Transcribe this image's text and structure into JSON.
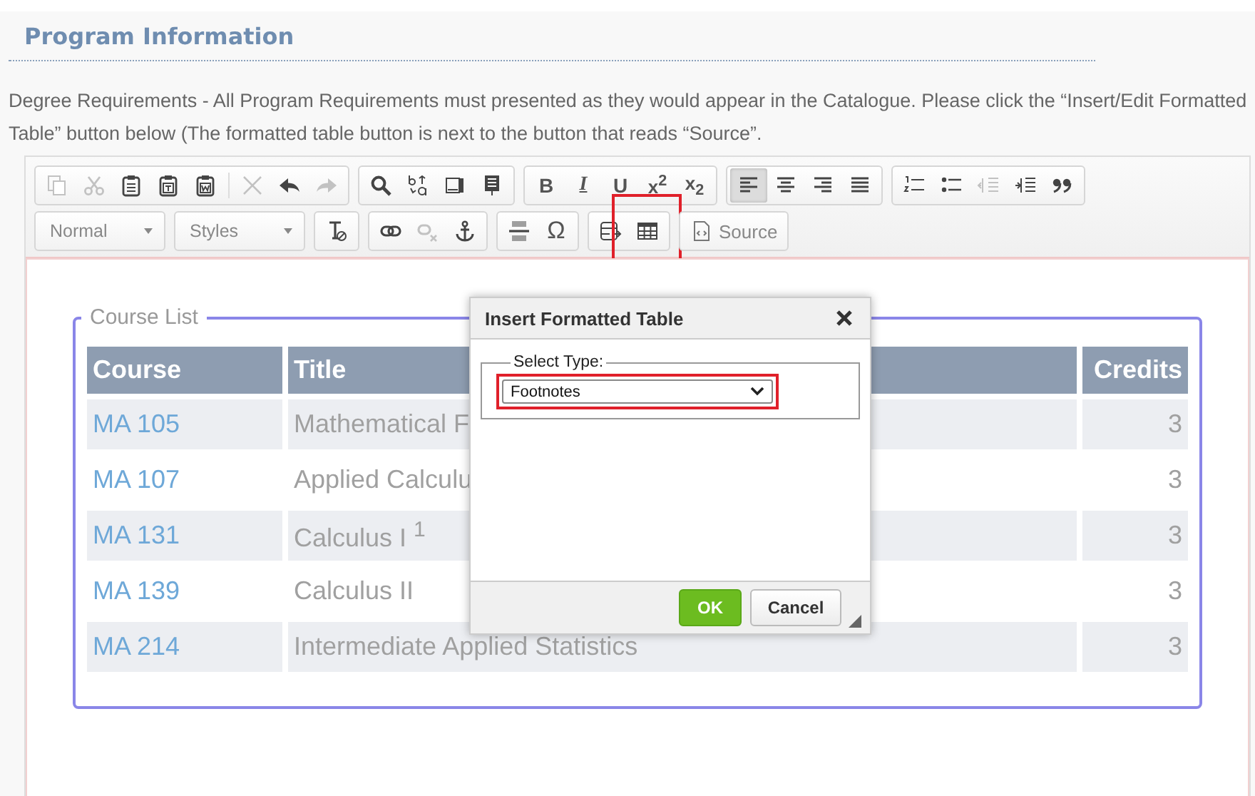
{
  "page": {
    "title": "Program Information",
    "instructions": "Degree Requirements - All Program Requirements must presented as they would appear in the Catalogue. Please click the “Insert/Edit Formatted Table” button below (The formatted table button is next to the button that reads “Source”."
  },
  "toolbar": {
    "rows": [
      [
        {
          "items": [
            {
              "kind": "copy",
              "disabled": true
            },
            {
              "kind": "cut",
              "disabled": true
            },
            {
              "kind": "paste",
              "disabled": false
            },
            {
              "kind": "pastetext",
              "disabled": false
            },
            {
              "kind": "pasteword",
              "disabled": false
            },
            {
              "kind": "sep"
            },
            {
              "kind": "remove",
              "disabled": true
            },
            {
              "kind": "undo",
              "disabled": false
            },
            {
              "kind": "redo",
              "disabled": true
            }
          ]
        },
        {
          "items": [
            {
              "kind": "find",
              "disabled": false
            },
            {
              "kind": "replace",
              "disabled": false
            },
            {
              "kind": "selectall",
              "disabled": false
            },
            {
              "kind": "page",
              "disabled": false
            }
          ]
        },
        {
          "items": [
            {
              "kind": "bold",
              "label": "B",
              "disabled": false
            },
            {
              "kind": "italic",
              "label": "I",
              "disabled": false
            },
            {
              "kind": "underline",
              "label": "U",
              "disabled": false
            },
            {
              "kind": "script",
              "label": "x$^{2}$",
              "disabled": false
            },
            {
              "kind": "script",
              "label": "x$_{2}$",
              "disabled": false
            }
          ]
        },
        {
          "items": [
            {
              "kind": "alignleft",
              "selected": true
            },
            {
              "kind": "aligncenter",
              "selected": false
            },
            {
              "kind": "alignright",
              "selected": false
            },
            {
              "kind": "justify",
              "selected": false
            }
          ]
        },
        {
          "items": [
            {
              "kind": "numlist",
              "disabled": false
            },
            {
              "kind": "bullist",
              "disabled": false
            },
            {
              "kind": "outdent",
              "disabled": true
            },
            {
              "kind": "indent",
              "disabled": false
            },
            {
              "kind": "quote",
              "disabled": false
            }
          ]
        }
      ],
      [
        {
          "items": [
            {
              "kind": "combo",
              "label": "Normal"
            }
          ]
        },
        {
          "items": [
            {
              "kind": "combo",
              "label": "Styles"
            }
          ]
        },
        {
          "items": [
            {
              "kind": "clearformat",
              "disabled": false
            }
          ]
        },
        {
          "items": [
            {
              "kind": "link",
              "disabled": false
            },
            {
              "kind": "unlink",
              "disabled": true
            },
            {
              "kind": "anchor",
              "disabled": false
            }
          ]
        },
        {
          "items": [
            {
              "kind": "hr",
              "disabled": false
            },
            {
              "kind": "char",
              "label": "Ω",
              "disabled": false
            }
          ]
        },
        {
          "items": [
            {
              "kind": "tableedit",
              "disabled": false
            },
            {
              "kind": "table",
              "disabled": false
            }
          ],
          "highlighted": true
        },
        {
          "items": [
            {
              "kind": "source",
              "label": "Source",
              "disabled": false
            }
          ]
        }
      ]
    ]
  },
  "course_list": {
    "legend": "Course List",
    "columns": [
      "Course",
      "Title",
      "Credits"
    ],
    "rows": [
      {
        "course": "MA 105",
        "title": "Mathematical F",
        "credits": "3"
      },
      {
        "course": "MA 107",
        "title": "Applied Calculu",
        "credits": "3"
      },
      {
        "course": "MA 131",
        "title": "Calculus I $^{1}$",
        "credits": "3"
      },
      {
        "course": "MA 139",
        "title": "Calculus II",
        "credits": "3"
      },
      {
        "course": "MA 214",
        "title": "Intermediate Applied Statistics",
        "credits": "3"
      }
    ]
  },
  "dialog": {
    "title": "Insert Formatted Table",
    "group_label": "Select Type:",
    "select": {
      "value": "Footnotes",
      "highlighted": true
    },
    "buttons": [
      {
        "label": "OK",
        "kind": "primary"
      },
      {
        "label": "Cancel",
        "kind": "secondary"
      }
    ]
  }
}
